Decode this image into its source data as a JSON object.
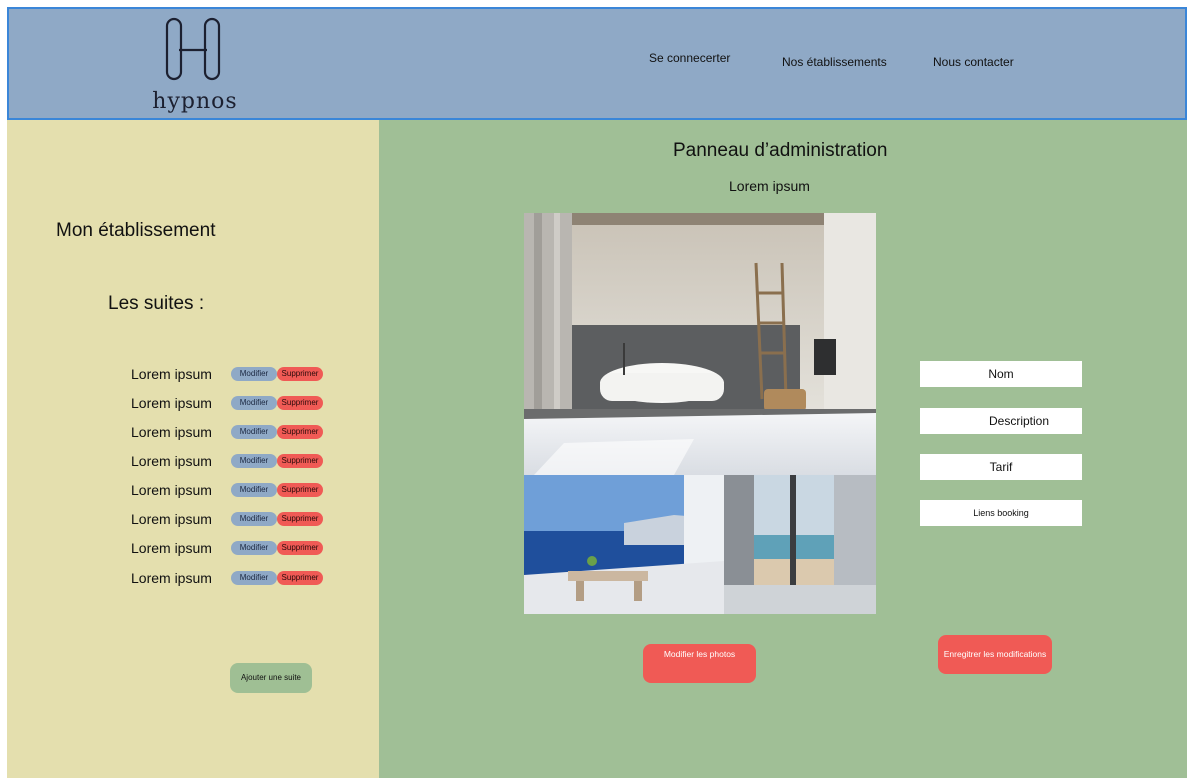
{
  "header": {
    "logo_text": "hypnos",
    "nav": [
      "Se connecerter",
      "Nos établissements",
      "Nous contacter"
    ]
  },
  "sidebar": {
    "title": "Mon établissement",
    "suites_title": "Les suites :",
    "suites": [
      {
        "label": "Lorem ipsum",
        "modify": "Modifier",
        "delete": "Supprimer"
      },
      {
        "label": "Lorem ipsum",
        "modify": "Modifier",
        "delete": "Supprimer"
      },
      {
        "label": "Lorem ipsum",
        "modify": "Modifier",
        "delete": "Supprimer"
      },
      {
        "label": "Lorem ipsum",
        "modify": "Modifier",
        "delete": "Supprimer"
      },
      {
        "label": "Lorem ipsum",
        "modify": "Modifier",
        "delete": "Supprimer"
      },
      {
        "label": "Lorem ipsum",
        "modify": "Modifier",
        "delete": "Supprimer"
      },
      {
        "label": "Lorem ipsum",
        "modify": "Modifier",
        "delete": "Supprimer"
      },
      {
        "label": "Lorem ipsum",
        "modify": "Modifier",
        "delete": "Supprimer"
      }
    ],
    "add_suite": "Ajouter une suite"
  },
  "main": {
    "title": "Panneau d’administration",
    "subtitle": "Lorem ipsum",
    "fields": {
      "name": "Nom",
      "description": "Description",
      "price": "Tarif",
      "booking": "Liens booking"
    },
    "modify_photos": "Modifier les photos",
    "save": "Enregitrer les modifications"
  },
  "colors": {
    "header": "#8fa9c6",
    "sidebar": "#e4dfae",
    "main": "#a0bf96",
    "accent_red": "#f05a55",
    "accent_blue": "#8fa9c6",
    "accent_green": "#9fbf94"
  }
}
